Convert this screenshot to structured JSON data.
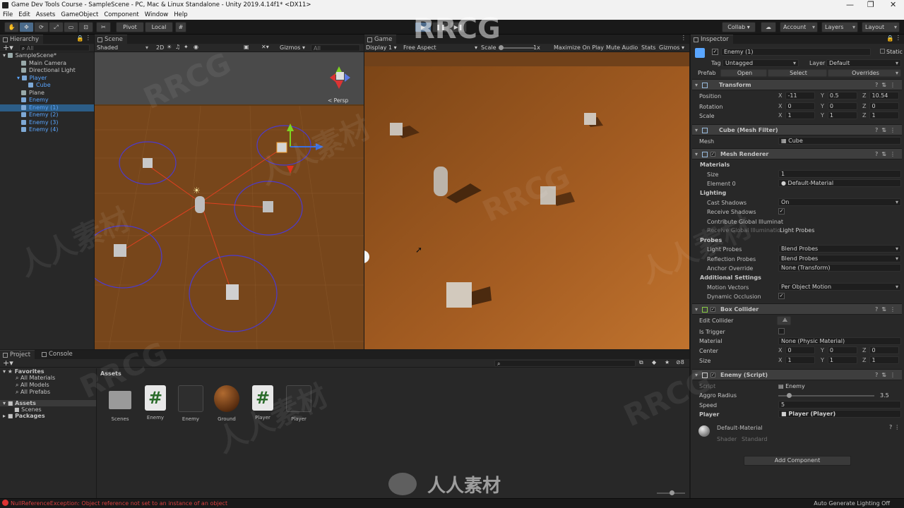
{
  "window": {
    "title": "Game Dev Tools Course - SampleScene - PC, Mac & Linux Standalone - Unity 2019.4.14f1* <DX11>"
  },
  "menu": [
    "File",
    "Edit",
    "Assets",
    "GameObject",
    "Component",
    "Window",
    "Help"
  ],
  "toolbar": {
    "pivot": "Pivot",
    "local": "Local",
    "collab": "Collab ▾",
    "account": "Account",
    "layers": "Layers",
    "layout": "Layout"
  },
  "hierarchy": {
    "tab": "Hierarchy",
    "search": "All",
    "items": [
      {
        "label": "SampleScene*",
        "depth": 0
      },
      {
        "label": "Main Camera",
        "depth": 1
      },
      {
        "label": "Directional Light",
        "depth": 1
      },
      {
        "label": "Player",
        "depth": 1
      },
      {
        "label": "Cube",
        "depth": 2
      },
      {
        "label": "Plane",
        "depth": 1
      },
      {
        "label": "Enemy",
        "depth": 1
      },
      {
        "label": "Enemy (1)",
        "depth": 1
      },
      {
        "label": "Enemy (2)",
        "depth": 1
      },
      {
        "label": "Enemy (3)",
        "depth": 1
      },
      {
        "label": "Enemy (4)",
        "depth": 1
      }
    ]
  },
  "scene": {
    "tab": "Scene",
    "shading": "Shaded",
    "mode2d": "2D",
    "gizmos": "Gizmos",
    "search": "All",
    "persp": "< Persp"
  },
  "game": {
    "tab": "Game",
    "display": "Display 1",
    "aspect": "Free Aspect",
    "scale_label": "Scale",
    "scale_value": "1x",
    "maximize": "Maximize On Play",
    "mute": "Mute Audio",
    "stats": "Stats",
    "gizmos": "Gizmos"
  },
  "project": {
    "tab_project": "Project",
    "tab_console": "Console",
    "favorites": "Favorites",
    "fav_items": [
      "All Materials",
      "All Models",
      "All Prefabs"
    ],
    "assets": "Assets",
    "asset_children": [
      "Scenes"
    ],
    "packages": "Packages",
    "crumb": "Assets",
    "hidden_count": "8",
    "grid": [
      {
        "label": "Scenes"
      },
      {
        "label": "Enemy"
      },
      {
        "label": "Enemy"
      },
      {
        "label": "Ground"
      },
      {
        "label": "Player"
      },
      {
        "label": "Player"
      }
    ]
  },
  "inspector": {
    "tab": "Inspector",
    "name": "Enemy (1)",
    "static": "Static ▾",
    "tag_label": "Tag",
    "tag": "Untagged",
    "layer_label": "Layer",
    "layer": "Default",
    "prefab_label": "Prefab",
    "prefab_open": "Open",
    "prefab_select": "Select",
    "prefab_overrides": "Overrides",
    "transform": {
      "title": "Transform",
      "position_label": "Position",
      "position": {
        "x": "-11",
        "y": "0.5",
        "z": "10.54"
      },
      "rotation_label": "Rotation",
      "rotation": {
        "x": "0",
        "y": "0",
        "z": "0"
      },
      "scale_label": "Scale",
      "scale": {
        "x": "1",
        "y": "1",
        "z": "1"
      }
    },
    "meshfilter": {
      "title": "Cube (Mesh Filter)",
      "mesh_label": "Mesh",
      "mesh": "Cube"
    },
    "meshrenderer": {
      "title": "Mesh Renderer",
      "materials": "Materials",
      "size_label": "Size",
      "size": "1",
      "element0_label": "Element 0",
      "element0": "Default-Material",
      "lighting": "Lighting",
      "cast_label": "Cast Shadows",
      "cast": "On",
      "receive_label": "Receive Shadows",
      "contribute_label": "Contribute Global Illuminat",
      "receive_gi_label": "Receive Global Illuminatio",
      "receive_gi": "Light Probes",
      "probes": "Probes",
      "light_probes_label": "Light Probes",
      "light_probes": "Blend Probes",
      "reflection_label": "Reflection Probes",
      "reflection": "Blend Probes",
      "anchor_label": "Anchor Override",
      "anchor": "None (Transform)",
      "additional": "Additional Settings",
      "motion_label": "Motion Vectors",
      "motion": "Per Object Motion",
      "dynamic_label": "Dynamic Occlusion"
    },
    "boxcollider": {
      "title": "Box Collider",
      "edit_label": "Edit Collider",
      "trigger_label": "Is Trigger",
      "material_label": "Material",
      "material": "None (Physic Material)",
      "center_label": "Center",
      "center": {
        "x": "0",
        "y": "0",
        "z": "0"
      },
      "size_label": "Size",
      "size": {
        "x": "1",
        "y": "1",
        "z": "1"
      }
    },
    "script": {
      "title": "Enemy (Script)",
      "script_label": "Script",
      "script": "Enemy",
      "aggro_label": "Aggro Radius",
      "aggro": "3.5",
      "aggro_fraction": 0.1,
      "speed_label": "Speed",
      "speed": "5",
      "player_label": "Player",
      "player": "Player (Player)"
    },
    "material": {
      "name": "Default-Material",
      "shader_label": "Shader",
      "shader": "Standard"
    },
    "add_component": "Add Component"
  },
  "status": {
    "error": "NullReferenceException: Object reference not set to an instance of an object",
    "right": "Auto Generate Lighting Off"
  },
  "watermarks": [
    "RRCG",
    "人人素材"
  ]
}
